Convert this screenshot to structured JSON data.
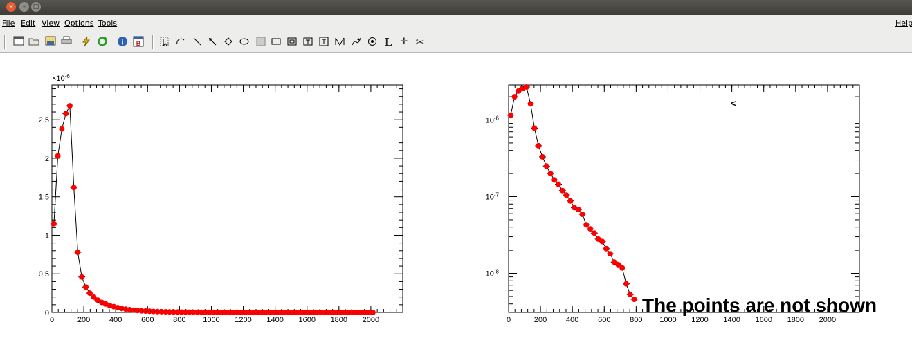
{
  "window": {
    "buttons": [
      "×",
      "–",
      "□"
    ]
  },
  "menu": {
    "file": "File",
    "edit": "Edit",
    "view": "View",
    "options": "Options",
    "tools": "Tools",
    "help": "Help"
  },
  "toolbar": {
    "icons": [
      "new-canvas-icon",
      "open-folder-icon",
      "save-icon",
      "print-icon",
      "lightning-icon",
      "refresh-icon",
      "info-icon",
      "browser-icon",
      "pointer-icon",
      "arc-icon",
      "line-icon",
      "arrow-icon",
      "diamond-icon",
      "ellipse-icon",
      "pad-icon",
      "pave-icon",
      "pave-label-icon",
      "pave-text-icon",
      "pave-box-text-icon",
      "graph-icon",
      "curly-line-icon",
      "marker-icon",
      "latex-icon",
      "cross-marker-icon",
      "cut-icon"
    ],
    "glyphs": {
      "latex": "L",
      "cross": "✛",
      "cut": "✂",
      "info": "i",
      "browser": "B"
    }
  },
  "colors": {
    "marker": "#ff0000",
    "line": "#000000"
  },
  "chart_data": [
    {
      "type": "line",
      "scale": "linear",
      "exponent_label": "×10",
      "exponent_sup": "-6",
      "xlim": [
        0,
        2200
      ],
      "ylim": [
        0,
        2.95
      ],
      "xticks": [
        0,
        200,
        400,
        600,
        800,
        1000,
        1200,
        1400,
        1600,
        1800,
        2000
      ],
      "xtick_labels": [
        "0",
        "200",
        "400",
        "600",
        "800",
        "1000",
        "1200",
        "1400",
        "1600",
        "1800",
        "2000"
      ],
      "yticks": [
        0,
        0.5,
        1,
        1.5,
        2,
        2.5
      ],
      "ytick_labels": [
        "0",
        "0.5",
        "1",
        "1.5",
        "2",
        "2.5"
      ],
      "series": [
        {
          "x": [
            12.5,
            37.5,
            62.5,
            87.5,
            112.5,
            137.5,
            162.5,
            187.5,
            212.5,
            237.5,
            262.5,
            287.5,
            312.5,
            337.5,
            362.5,
            387.5,
            412.5,
            437.5,
            462.5,
            487.5,
            512.5,
            537.5,
            562.5,
            587.5,
            612.5,
            637.5,
            662.5,
            687.5,
            712.5,
            737.5,
            762.5,
            787.5,
            812.5,
            837.5,
            862.5,
            887.5,
            912.5,
            937.5,
            962.5,
            987.5,
            1012.5,
            1037.5,
            1062.5,
            1087.5,
            1112.5,
            1137.5,
            1162.5,
            1187.5,
            1212.5,
            1237.5,
            1262.5,
            1287.5,
            1312.5,
            1337.5,
            1362.5,
            1387.5,
            1412.5,
            1437.5,
            1462.5,
            1487.5,
            1512.5,
            1537.5,
            1562.5,
            1587.5,
            1612.5,
            1637.5,
            1662.5,
            1687.5,
            1712.5,
            1737.5,
            1762.5,
            1787.5,
            1812.5,
            1837.5,
            1862.5,
            1887.5,
            1912.5,
            1937.5,
            1962.5,
            1987.5,
            2012.5
          ],
          "y": [
            1.15,
            2.03,
            2.38,
            2.58,
            2.68,
            1.62,
            0.78,
            0.46,
            0.33,
            0.25,
            0.2,
            0.16,
            0.13,
            0.11,
            0.09,
            0.075,
            0.062,
            0.052,
            0.043,
            0.036,
            0.03,
            0.025,
            0.021,
            0.018,
            0.015,
            0.013,
            0.011,
            0.0095,
            0.0082,
            0.0071,
            0.0062,
            0.0054,
            0.0047,
            0.0041,
            0.0036,
            0.0032,
            0.0028,
            0.0025,
            0.0022,
            0.0019,
            0.0017,
            0.0015,
            0.0013,
            0.0012,
            0.001,
            0.0009,
            0.0008,
            0.0007,
            0.0006,
            0.0005,
            0.0005,
            0.0004,
            0.0004,
            0.0003,
            0.0003,
            0.0003,
            0.0002,
            0.0002,
            0.0002,
            0.0002,
            0.0001,
            0.0001,
            0.0001,
            0.0001,
            0.0001,
            0.0001,
            0.0001,
            0.0001,
            0.0001,
            0.0001,
            0.0001,
            0.0001,
            0.0001,
            0.0001,
            0.0001,
            0.0001,
            0.0001,
            0.0001,
            0.0001,
            0.0001,
            0.0001
          ]
        }
      ]
    },
    {
      "type": "line",
      "scale": "log",
      "xlim": [
        0,
        2200
      ],
      "ylim": [
        3.1e-09,
        2.85e-06
      ],
      "xticks": [
        0,
        200,
        400,
        600,
        800,
        1000,
        1200,
        1400,
        1600,
        1800,
        2000
      ],
      "xtick_labels": [
        "0",
        "200",
        "400",
        "600",
        "800",
        "1000",
        "1200",
        "1400",
        "1600",
        "1800",
        "2000"
      ],
      "yticks": [
        1e-08,
        1e-07,
        1e-06
      ],
      "ytick_bases": [
        "10",
        "10",
        "10"
      ],
      "ytick_sups": [
        "-8",
        "-7",
        "-6"
      ],
      "series": [
        {
          "x": [
            12.5,
            37.5,
            62.5,
            87.5,
            112.5,
            137.5,
            162.5,
            187.5,
            212.5,
            237.5,
            262.5,
            287.5,
            312.5,
            337.5,
            362.5,
            387.5,
            412.5,
            437.5,
            462.5,
            487.5,
            512.5,
            537.5,
            562.5,
            587.5,
            612.5,
            637.5,
            662.5,
            687.5,
            712.5,
            737.5,
            762.5,
            787.5
          ],
          "y": [
            1.15e-06,
            2e-06,
            2.38e-06,
            2.58e-06,
            2.68e-06,
            1.62e-06,
            7.8e-07,
            4.6e-07,
            3.3e-07,
            2.5e-07,
            2e-07,
            1.65e-07,
            1.45e-07,
            1.2e-07,
            1.05e-07,
            8.8e-08,
            7.2e-08,
            6.8e-08,
            5.9e-08,
            4.3e-08,
            3.8e-08,
            3.35e-08,
            2.8e-08,
            2.6e-08,
            2.1e-08,
            1.8e-08,
            1.4e-08,
            1.3e-08,
            1.18e-08,
            7.3e-09,
            5.3e-09,
            4.6e-09
          ]
        }
      ],
      "annotations": [
        "<"
      ],
      "note": "The points are not shown"
    }
  ]
}
